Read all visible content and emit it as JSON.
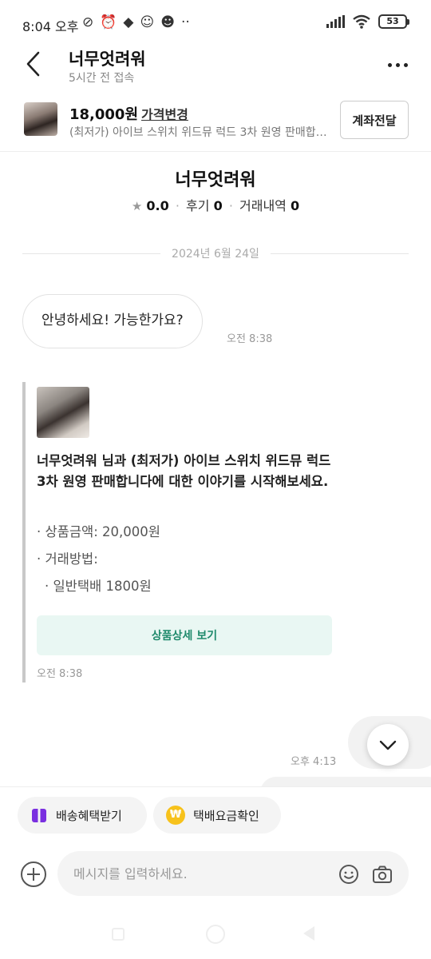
{
  "status_bar": {
    "time": "8:04 오후",
    "battery": "53"
  },
  "header": {
    "name": "너무엇려워",
    "last_seen": "5시간 전 접속"
  },
  "product": {
    "price": "18,000원",
    "change_price_label": "가격변경",
    "title": "(최저가) 아이브 스위치 위드뮤 럭드 3차 원영 판매합니다",
    "transfer_label": "계좌전달"
  },
  "profile": {
    "name": "너무엇려워",
    "rating": "0.0",
    "reviews_label": "후기",
    "reviews_count": "0",
    "transactions_label": "거래내역",
    "transactions_count": "0"
  },
  "chat": {
    "date": "2024년 6월 24일",
    "messages": [
      {
        "text": "안녕하세요! 가능한가요?",
        "time": "오전 8:38"
      }
    ],
    "system_card": {
      "text": "너무엇려워 님과 (최저가) 아이브 스위치 위드뮤 럭드 3차 원영 판매합니다에 대한 이야기를 시작해보세요.",
      "price_line": "· 상품금액: 20,000원",
      "method_line": "· 거래방법:",
      "shipping_line": "· 일반택배 1800원",
      "detail_button": "상품상세 보기",
      "time": "오전 8:38"
    },
    "outgoing_time": "오후 4:13"
  },
  "bottom": {
    "chips": [
      {
        "label": "배송혜택받기",
        "icon": "gift-icon"
      },
      {
        "label": "택배요금확인",
        "icon": "won-coin-icon"
      }
    ],
    "input_placeholder": "메시지를 입력하세요."
  },
  "colors": {
    "accent_green": "#1f8a6c",
    "detail_button_bg": "#e9f7f3",
    "gift_purple": "#7a2fe0",
    "coin_yellow": "#f7c21c"
  }
}
